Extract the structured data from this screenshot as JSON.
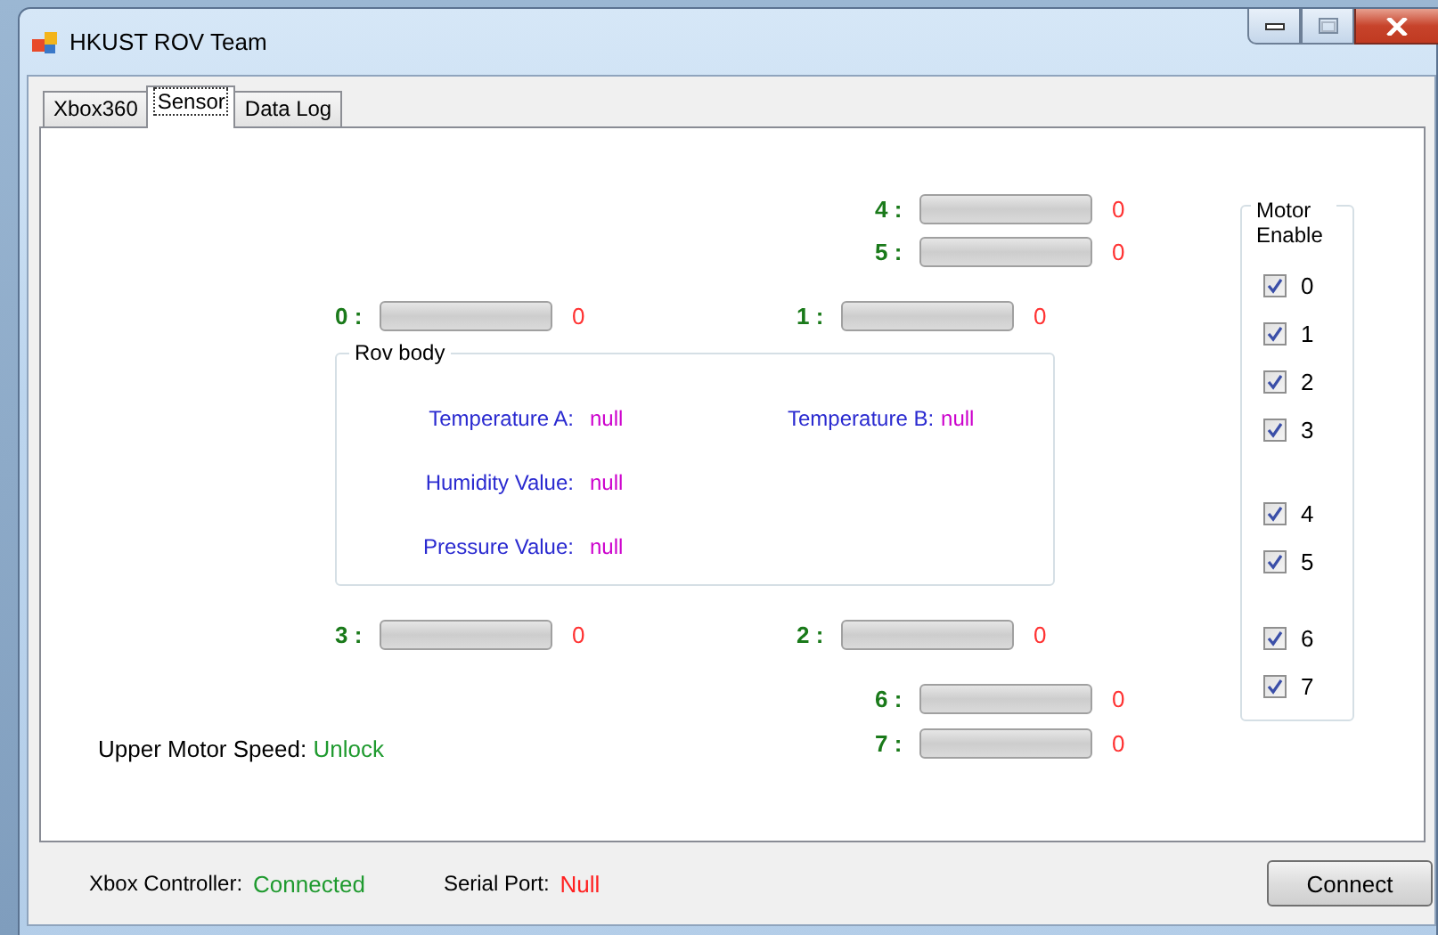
{
  "window": {
    "title": "HKUST ROV Team"
  },
  "tabs": [
    {
      "label": "Xbox360",
      "selected": false
    },
    {
      "label": "Sensor",
      "selected": true
    },
    {
      "label": "Data Log",
      "selected": false
    }
  ],
  "motors": [
    {
      "label": "4 :",
      "level": 0,
      "reading": "0"
    },
    {
      "label": "5 :",
      "level": 0,
      "reading": "0"
    },
    {
      "label": "0 :",
      "level": 0,
      "reading": "0"
    },
    {
      "label": "1 :",
      "level": 0,
      "reading": "0"
    },
    {
      "label": "3 :",
      "level": 0,
      "reading": "0"
    },
    {
      "label": "2 :",
      "level": 0,
      "reading": "0"
    },
    {
      "label": "6 :",
      "level": 0,
      "reading": "0"
    },
    {
      "label": "7 :",
      "level": 0,
      "reading": "0"
    }
  ],
  "rov_body": {
    "title": "Rov body",
    "fields": [
      {
        "label": "Temperature A:",
        "value": "null"
      },
      {
        "label": "Temperature B:",
        "value": "null"
      },
      {
        "label": "Humidity Value:",
        "value": "null"
      },
      {
        "label": "Pressure Value:",
        "value": "null"
      }
    ]
  },
  "upper_motor_speed": {
    "label": "Upper Motor Speed:",
    "value": "Unlock"
  },
  "motor_enable": {
    "title": "Motor Enable",
    "items": [
      {
        "label": "0",
        "checked": true
      },
      {
        "label": "1",
        "checked": true
      },
      {
        "label": "2",
        "checked": true
      },
      {
        "label": "3",
        "checked": true
      },
      {
        "label": "4",
        "checked": true
      },
      {
        "label": "5",
        "checked": true
      },
      {
        "label": "6",
        "checked": true
      },
      {
        "label": "7",
        "checked": true
      }
    ]
  },
  "status": [
    {
      "label": "Xbox Controller:",
      "value": "Connected",
      "color": "#1f9a2f"
    },
    {
      "label": "Serial Port:",
      "value": "Null",
      "color": "#ff2020"
    }
  ],
  "buttons": [
    "Connect"
  ]
}
